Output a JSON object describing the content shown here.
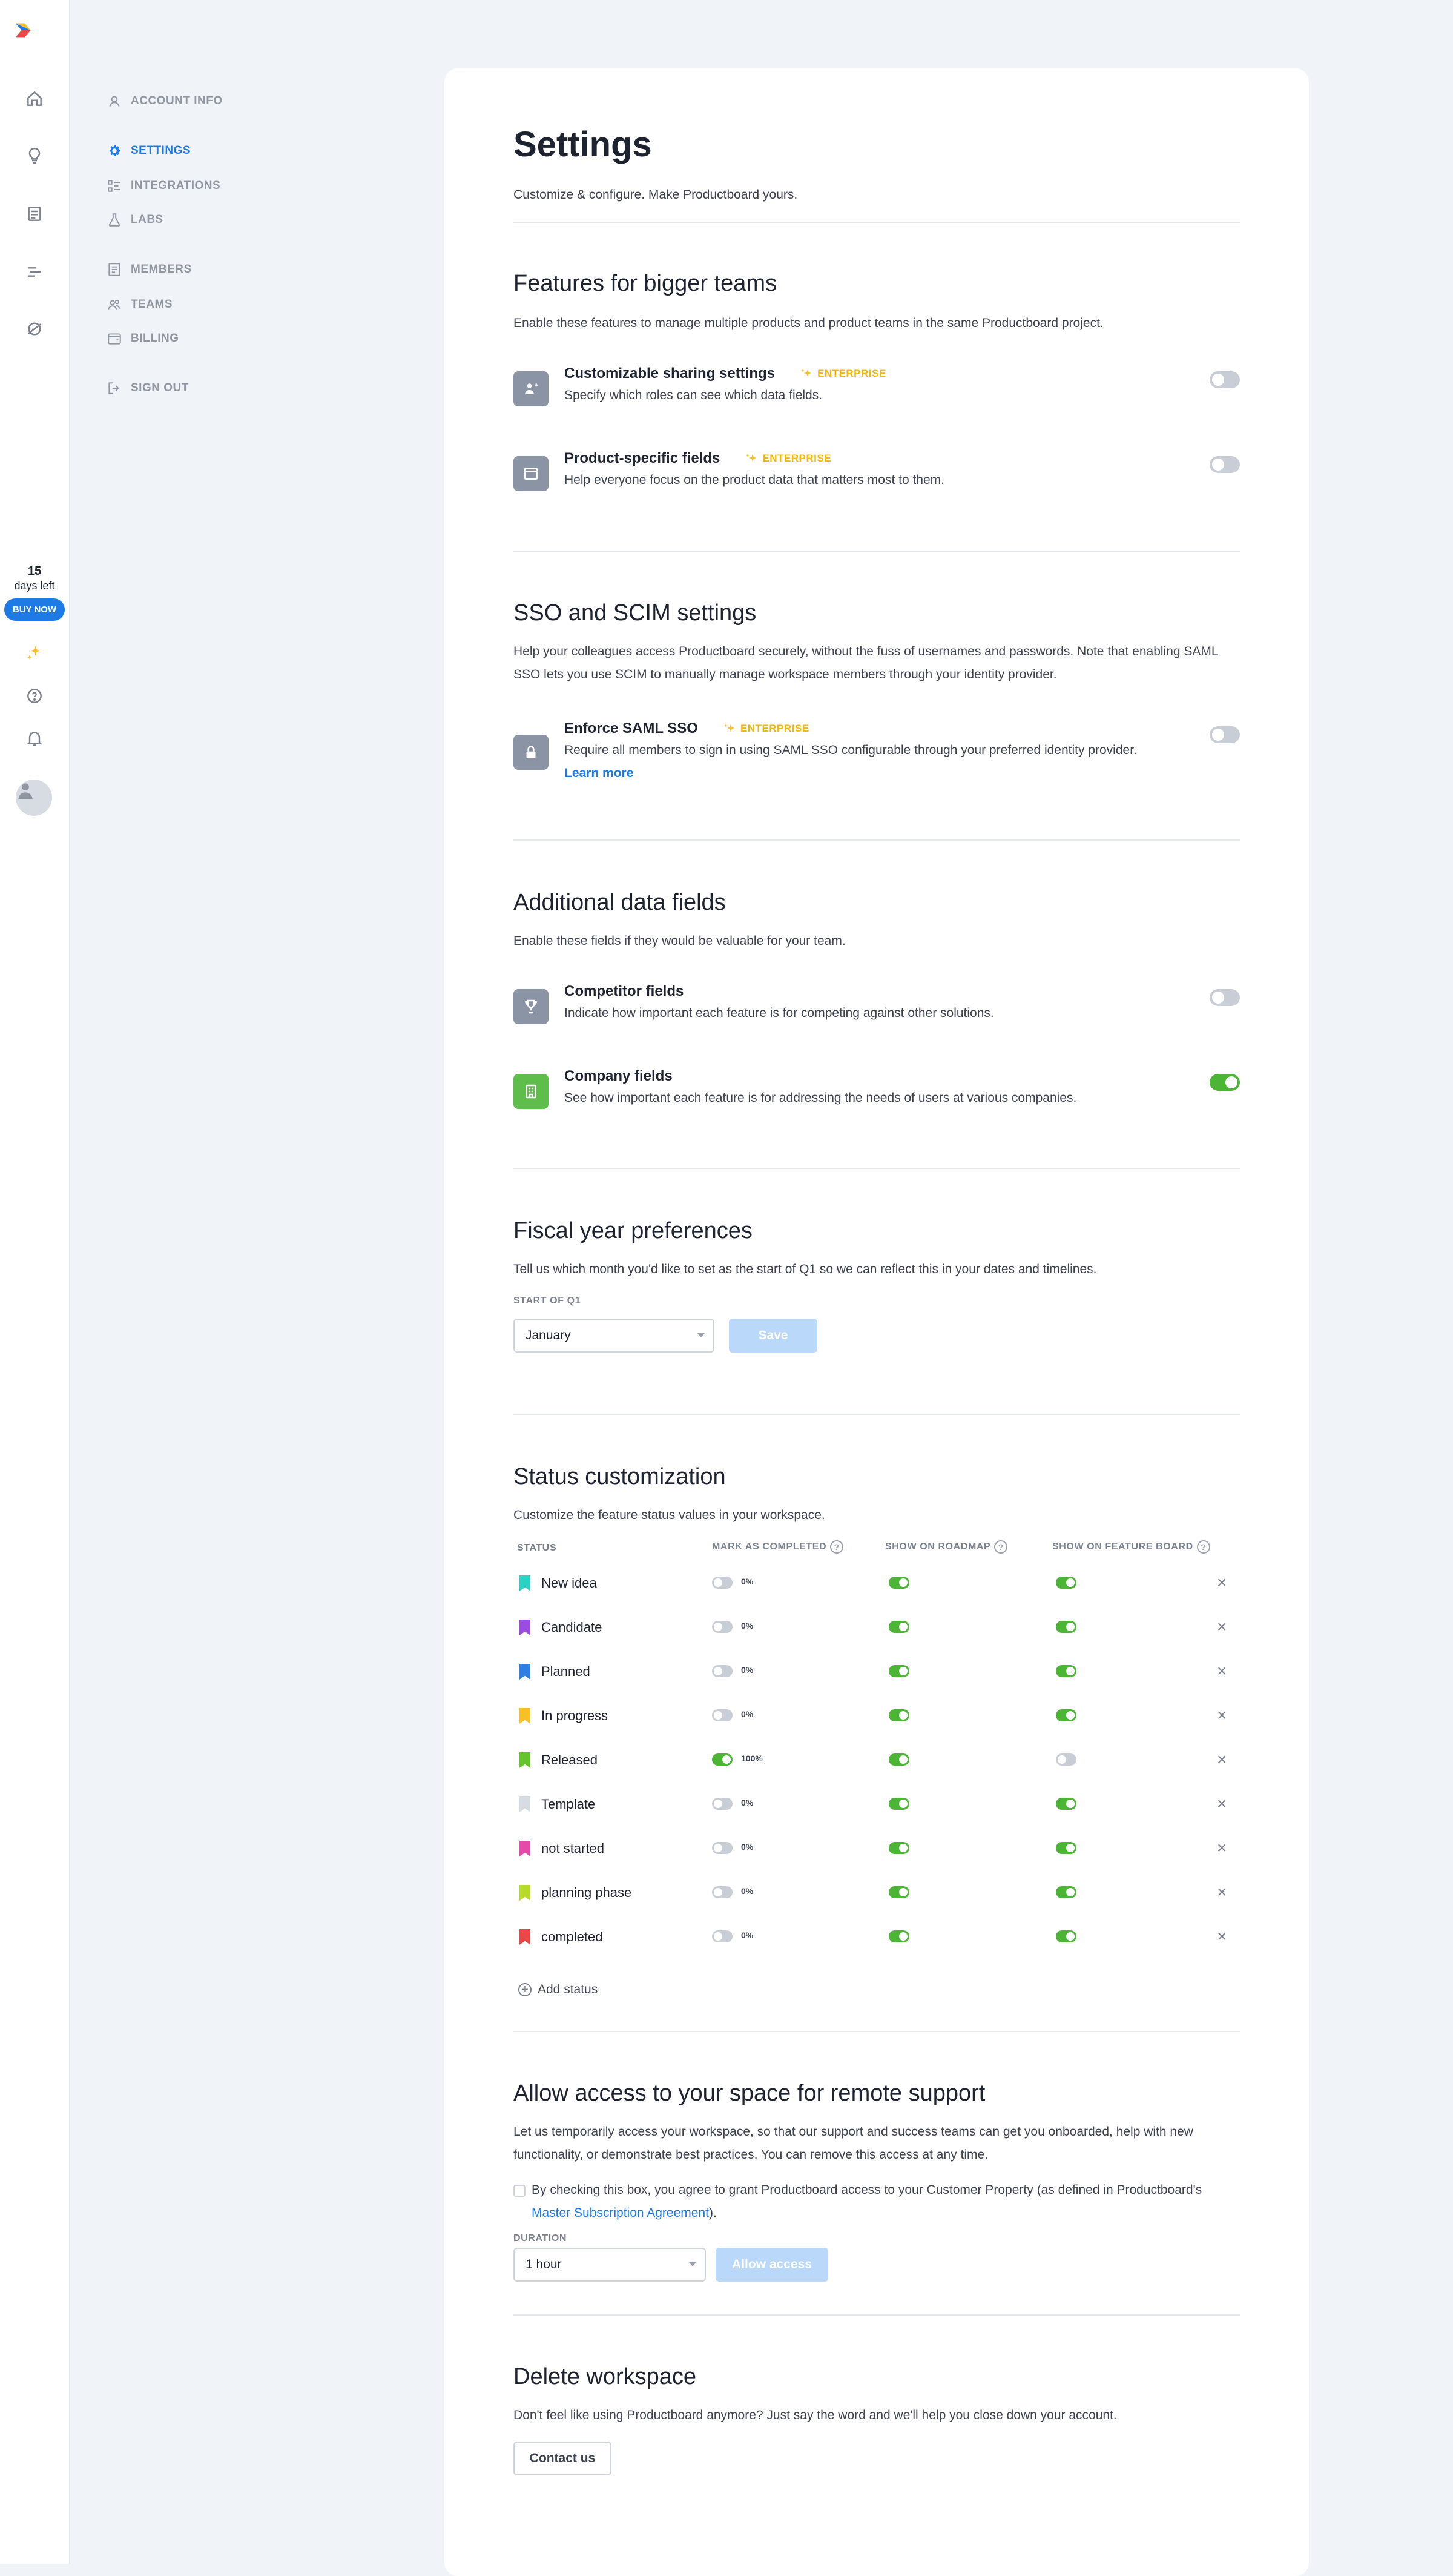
{
  "rail": {
    "trial_days": "15",
    "trial_label": "days left",
    "buy_label": "BUY NOW"
  },
  "nav": {
    "items": [
      {
        "label": "ACCOUNT INFO",
        "icon": "user-icon"
      },
      {
        "label": "SETTINGS",
        "icon": "gear-icon",
        "active": true
      },
      {
        "label": "INTEGRATIONS",
        "icon": "integrations-icon"
      },
      {
        "label": "LABS",
        "icon": "flask-icon"
      },
      {
        "label": "MEMBERS",
        "icon": "members-icon"
      },
      {
        "label": "TEAMS",
        "icon": "teams-icon"
      },
      {
        "label": "BILLING",
        "icon": "wallet-icon"
      },
      {
        "label": "SIGN OUT",
        "icon": "sign-out-icon"
      }
    ]
  },
  "page": {
    "title": "Settings",
    "subtitle": "Customize & configure. Make Productboard yours."
  },
  "features": {
    "title": "Features for bigger teams",
    "desc": "Enable these features to manage multiple products and product teams in the same Productboard project.",
    "items": [
      {
        "title": "Customizable sharing settings",
        "badge": "ENTERPRISE",
        "desc": "Specify which roles can see which data fields.",
        "enabled": false
      },
      {
        "title": "Product-specific fields",
        "badge": "ENTERPRISE",
        "desc": "Help everyone focus on the product data that matters most to them.",
        "enabled": false
      }
    ]
  },
  "sso": {
    "title": "SSO and SCIM settings",
    "desc_line1": "Help your colleagues access Productboard securely, without the fuss of usernames and passwords. Note that enabling SAML",
    "desc_line2": "SSO lets you use SCIM to manually manage workspace members through your identity provider.",
    "item": {
      "title": "Enforce SAML SSO",
      "badge": "ENTERPRISE",
      "desc": "Require all members to sign in using SAML SSO configurable through your preferred identity provider.",
      "link": "Learn more",
      "enabled": false
    }
  },
  "data_fields": {
    "title": "Additional data fields",
    "desc": "Enable these fields if they would be valuable for your team.",
    "items": [
      {
        "title": "Competitor fields",
        "desc": "Indicate how important each feature is for competing against other solutions.",
        "enabled": false
      },
      {
        "title": "Company fields",
        "desc": "See how important each feature is for addressing the needs of users at various companies.",
        "enabled": true
      }
    ]
  },
  "fiscal": {
    "title": "Fiscal year preferences",
    "desc": "Tell us which month you'd like to set as the start of Q1 so we can reflect this in your dates and timelines.",
    "field_label": "START OF Q1",
    "value": "January",
    "save_label": "Save"
  },
  "status": {
    "title": "Status customization",
    "desc": "Customize the feature status values in your workspace.",
    "headers": {
      "status": "STATUS",
      "completed": "MARK AS COMPLETED",
      "roadmap": "SHOW ON ROADMAP",
      "board": "SHOW ON FEATURE BOARD"
    },
    "help_glyph": "?",
    "remove_glyph": "×",
    "add_label": "Add status",
    "rows": [
      {
        "name": "New idea",
        "color": "#2ad1c4",
        "completed": false,
        "pct": "0%",
        "roadmap": true,
        "board": true
      },
      {
        "name": "Candidate",
        "color": "#9b4de0",
        "completed": false,
        "pct": "0%",
        "roadmap": true,
        "board": true
      },
      {
        "name": "Planned",
        "color": "#2f7fe0",
        "completed": false,
        "pct": "0%",
        "roadmap": true,
        "board": true
      },
      {
        "name": "In progress",
        "color": "#f6c026",
        "completed": false,
        "pct": "0%",
        "roadmap": true,
        "board": true
      },
      {
        "name": "Released",
        "color": "#63c42c",
        "completed": true,
        "pct": "100%",
        "roadmap": true,
        "board": false
      },
      {
        "name": "Template",
        "color": "#d7dbe2",
        "completed": false,
        "pct": "0%",
        "roadmap": true,
        "board": true
      },
      {
        "name": "not started",
        "color": "#e64aa9",
        "completed": false,
        "pct": "0%",
        "roadmap": true,
        "board": true
      },
      {
        "name": "planning phase",
        "color": "#b7d92a",
        "completed": false,
        "pct": "0%",
        "roadmap": true,
        "board": true
      },
      {
        "name": "completed",
        "color": "#ea4747",
        "completed": false,
        "pct": "0%",
        "roadmap": true,
        "board": true
      }
    ]
  },
  "remote": {
    "title": "Allow access to your space for remote support",
    "desc_line1": "Let us temporarily access your workspace, so that our support and success teams can get you onboarded, help with new",
    "desc_line2": "functionality, or demonstrate best practices. You can remove this access at any time.",
    "consent_text": "By checking this box, you agree to grant Productboard access to your Customer Property (as defined in Productboard's",
    "consent_link": "Master Subscription Agreement",
    "consent_end": ").",
    "duration_label": "DURATION",
    "duration_value": "1 hour",
    "allow_label": "Allow access"
  },
  "delete": {
    "title": "Delete workspace",
    "desc": "Don't feel like using Productboard anymore? Just say the word and we'll help you close down your account.",
    "contact_label": "Contact us"
  }
}
